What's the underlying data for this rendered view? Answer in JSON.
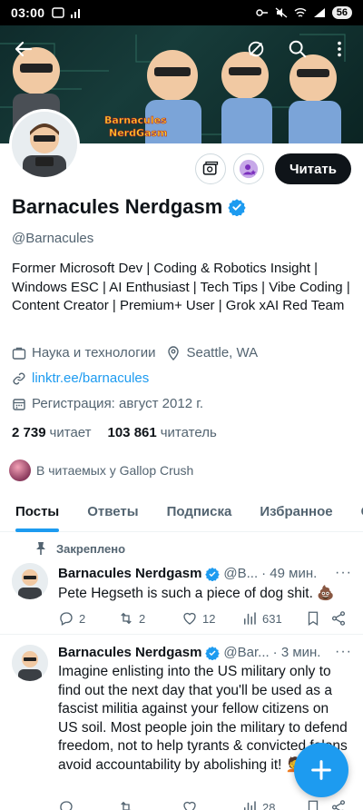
{
  "status_bar": {
    "time": "03:00",
    "battery": "56"
  },
  "profile": {
    "name": "Barnacules Nerdgasm",
    "handle": "@Barnacules",
    "bio": "Former Microsoft Dev | Coding & Robotics Insight | Windows ESC | AI Enthusiast | Tech Tips | Vibe Coding | Content Creator | Premium+ User | Grok xAI Red Team",
    "category": "Наука и технологии",
    "location": "Seattle, WA",
    "link": "linktr.ee/barnacules",
    "joined": "Регистрация: август 2012 г.",
    "following_count": "2 739",
    "following_label": "читает",
    "followers_count": "103 861",
    "followers_label": "читатель",
    "followed_by": "В читаемых у Gallop Crush",
    "banner_logo_line1": "Barnacules",
    "banner_logo_line2": "NerdGasm"
  },
  "buttons": {
    "follow": "Читать"
  },
  "tabs": [
    "Посты",
    "Ответы",
    "Подписка",
    "Избранное",
    "Ст"
  ],
  "pinned_label": "Закреплено",
  "tweets": [
    {
      "name": "Barnacules Nerdgasm",
      "handle": "@B...",
      "time": "· 49 мин.",
      "text": "Pete Hegseth is such a piece of dog shit. 💩",
      "replies": "2",
      "retweets": "2",
      "likes": "12",
      "views": "631"
    },
    {
      "name": "Barnacules Nerdgasm",
      "handle": "@Bar...",
      "time": "· 3 мин.",
      "text": "Imagine enlisting into the US military only to find out the next day that you'll be used as a fascist militia against your fellow citizens on US soil. Most people join the military to defend freedom, not to help tyrants & convicted felons avoid accountability by abolishing it! 🤦",
      "views": "28"
    }
  ],
  "colors": {
    "accent": "#1d9bf0",
    "text": "#0f1419",
    "muted": "#536471",
    "follow_bg": "#0f1419"
  },
  "icons": [
    "back-arrow-icon",
    "edit-off-icon",
    "search-icon",
    "more-vert-icon",
    "subscribe-card-icon",
    "notification-add-icon",
    "verified-badge-icon",
    "category-icon",
    "location-icon",
    "link-icon",
    "calendar-icon",
    "pin-icon",
    "reply-icon",
    "retweet-icon",
    "like-icon",
    "views-icon",
    "bookmark-icon",
    "share-icon",
    "compose-plus-icon"
  ]
}
